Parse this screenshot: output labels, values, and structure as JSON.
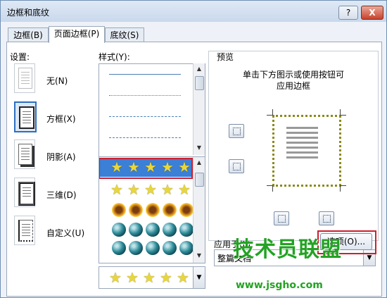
{
  "title": "边框和底纹",
  "titlebar": {
    "help": "?",
    "close": "X"
  },
  "tabs": [
    {
      "label": "边框(B)"
    },
    {
      "label": "页面边框(P)"
    },
    {
      "label": "底纹(S)"
    }
  ],
  "settings": {
    "label": "设置:",
    "items": [
      {
        "label": "无(N)"
      },
      {
        "label": "方框(X)"
      },
      {
        "label": "阴影(A)"
      },
      {
        "label": "三维(D)"
      },
      {
        "label": "自定义(U)"
      }
    ]
  },
  "style": {
    "label": "样式(Y):"
  },
  "preview": {
    "label": "预览",
    "hint_line1": "单击下方图示或使用按钮可",
    "hint_line2": "应用边框"
  },
  "apply_to": {
    "label": "应用于(L):",
    "value": "整篇文档"
  },
  "options_button": "选项(O)...",
  "watermark": {
    "main": "技术员联盟",
    "url": "www.jsgho.com"
  }
}
